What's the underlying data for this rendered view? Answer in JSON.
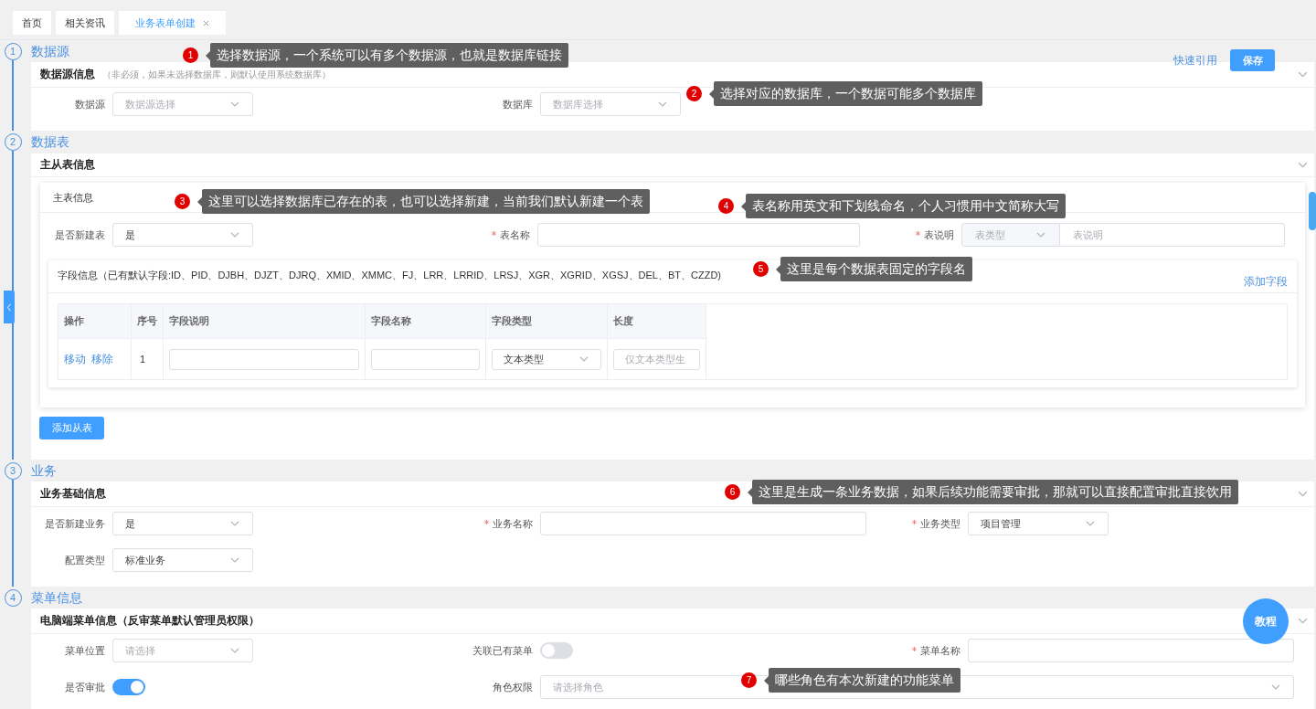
{
  "tabs": [
    {
      "label": "首页",
      "selected": false,
      "closable": false
    },
    {
      "label": "相关资讯",
      "selected": false,
      "closable": false
    },
    {
      "label": "业务表单创建",
      "selected": true,
      "closable": true
    }
  ],
  "actions": {
    "quick_reference": "快速引用",
    "save": "保存"
  },
  "steps": [
    {
      "number": "1",
      "title": "数据源",
      "kind": "form",
      "panel": {
        "title": "数据源信息",
        "note": "（非必须，如果未选择数据库，则默认使用系统数据库）",
        "rows": [
          [
            {
              "label": "数据源",
              "kind": "select",
              "required": false,
              "placeholder": "数据源选择"
            },
            {
              "label": "数据库",
              "kind": "select",
              "required": false,
              "placeholder": "数据库选择"
            }
          ]
        ]
      }
    },
    {
      "number": "2",
      "title": "数据表",
      "kind": "tables",
      "panel": {
        "title": "主从表信息",
        "master": {
          "title": "主表信息",
          "rows": [
            [
              {
                "label": "是否新建表",
                "kind": "select",
                "required": false,
                "value": "是"
              },
              {
                "label": "表名称",
                "kind": "input",
                "required": true
              },
              {
                "label": "表说明",
                "kind": "type_input",
                "required": true,
                "type_placeholder": "表类型",
                "placeholder": "表说明"
              }
            ]
          ],
          "fields": {
            "title": "字段信息（已有默认字段:ID、PID、DJBH、DJZT、DJRQ、XMID、XMMC、FJ、LRR、LRRID、LRSJ、XGR、XGRID、XGSJ、DEL、BT、CZZD)",
            "add_link": "添加字段",
            "columns": [
              "操作",
              "序号",
              "字段说明",
              "字段名称",
              "字段类型",
              "长度"
            ],
            "rows": [
              {
                "cells": [
                  {
                    "kind": "actions",
                    "actions": [
                      "移动",
                      "移除"
                    ]
                  },
                  {
                    "kind": "text",
                    "text": "1"
                  },
                  {
                    "kind": "input"
                  },
                  {
                    "kind": "input"
                  },
                  {
                    "kind": "select",
                    "value": "文本类型"
                  },
                  {
                    "kind": "input",
                    "placeholder": "仅文本类型生"
                  }
                ]
              }
            ]
          }
        },
        "add_button": "添加从表"
      }
    },
    {
      "number": "3",
      "title": "业务",
      "kind": "form",
      "panel": {
        "title": "业务基础信息",
        "rows": [
          [
            {
              "label": "是否新建业务",
              "kind": "select",
              "required": false,
              "value": "是"
            },
            {
              "label": "业务名称",
              "kind": "input",
              "required": true
            },
            {
              "label": "业务类型",
              "kind": "select",
              "required": true,
              "value": "项目管理"
            }
          ],
          [
            {
              "label": "配置类型",
              "kind": "select",
              "required": false,
              "value": "标准业务"
            }
          ]
        ]
      }
    },
    {
      "number": "4",
      "title": "菜单信息",
      "kind": "form",
      "panel": {
        "title": "电脑端菜单信息（反审菜单默认管理员权限）",
        "rows": [
          [
            {
              "label": "菜单位置",
              "kind": "select",
              "required": false,
              "placeholder": "请选择"
            },
            {
              "label": "关联已有菜单",
              "kind": "switch",
              "required": false,
              "on": false
            },
            {
              "label": "菜单名称",
              "kind": "input",
              "required": true
            }
          ],
          [
            {
              "label": "是否审批",
              "kind": "switch",
              "required": false,
              "on": true
            },
            {
              "label": "角色权限",
              "kind": "wide_select",
              "required": false,
              "placeholder": "请选择角色"
            }
          ]
        ]
      }
    }
  ],
  "help_button": "教程",
  "annotations": [
    {
      "number": "1",
      "text": "选择数据源，一个系统可以有多个数据源，也就是数据库链接"
    },
    {
      "number": "2",
      "text": "选择对应的数据库，一个数据可能多个数据库"
    },
    {
      "number": "3",
      "text": "这里可以选择数据库已存在的表，也可以选择新建，当前我们默认新建一个表"
    },
    {
      "number": "4",
      "text": "表名称用英文和下划线命名，个人习惯用中文简称大写"
    },
    {
      "number": "5",
      "text": "这里是每个数据表固定的字段名"
    },
    {
      "number": "6",
      "text": "这里是生成一条业务数据，如果后续功能需要审批，那就可以直接配置审批直接饮用"
    },
    {
      "number": "7",
      "text": "哪些角色有本次新建的功能菜单"
    }
  ]
}
